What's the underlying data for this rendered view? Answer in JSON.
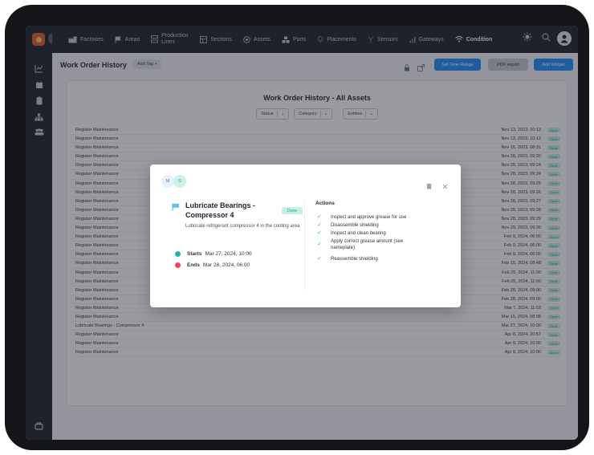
{
  "nav": {
    "items": [
      {
        "label": "Factories",
        "icon": "factory-icon"
      },
      {
        "label": "Areas",
        "icon": "flag-icon"
      },
      {
        "label": "Production Lines",
        "icon": "production-line-icon"
      },
      {
        "label": "Sections",
        "icon": "section-icon"
      },
      {
        "label": "Assets",
        "icon": "asset-icon"
      },
      {
        "label": "Parts",
        "icon": "parts-icon"
      },
      {
        "label": "Placements",
        "icon": "placement-icon"
      },
      {
        "label": "Sensors",
        "icon": "sensor-icon"
      },
      {
        "label": "Gateways",
        "icon": "gateway-icon"
      },
      {
        "label": "Condition",
        "icon": "condition-icon"
      }
    ]
  },
  "header": {
    "title": "Work Order History",
    "add_tag": "Add Tag +",
    "set_time_range": "Set Time Range",
    "pdf_export": "PDF export",
    "add_widget": "Add Widget"
  },
  "panel": {
    "title": "Work Order History - All Assets",
    "filters": [
      "Status",
      "Category",
      "Entities"
    ]
  },
  "rows": [
    {
      "name": "Register Maintenance",
      "date": "Nov 13, 2023, 10:13",
      "status": "Done"
    },
    {
      "name": "Register Maintenance",
      "date": "Nov 13, 2023, 10:13",
      "status": "Done"
    },
    {
      "name": "Register Maintenance",
      "date": "Nov 15, 2023, 08:31",
      "status": "Done"
    },
    {
      "name": "Register Maintenance",
      "date": "Nov 28, 2023, 09:20",
      "status": "Done"
    },
    {
      "name": "Register Maintenance",
      "date": "Nov 28, 2023, 09:24",
      "status": "Done"
    },
    {
      "name": "Register Maintenance",
      "date": "Nov 28, 2023, 09:24",
      "status": "Done"
    },
    {
      "name": "Register Maintenance",
      "date": "Nov 28, 2023, 09:25",
      "status": "Done"
    },
    {
      "name": "Register Maintenance",
      "date": "Nov 28, 2023, 09:26",
      "status": "Done"
    },
    {
      "name": "Register Maintenance",
      "date": "Nov 28, 2023, 09:27",
      "status": "Done"
    },
    {
      "name": "Register Maintenance",
      "date": "Nov 28, 2023, 09:28",
      "status": "Done"
    },
    {
      "name": "Register Maintenance",
      "date": "Nov 28, 2023, 09:29",
      "status": "Done"
    },
    {
      "name": "Register Maintenance",
      "date": "Nov 29, 2023, 09:30",
      "status": "Done"
    },
    {
      "name": "Register Maintenance",
      "date": "Feb 9, 2024, 06:00",
      "status": "Done"
    },
    {
      "name": "Register Maintenance",
      "date": "Feb 9, 2024, 06:00",
      "status": "Done"
    },
    {
      "name": "Register Maintenance",
      "date": "Feb 9, 2024, 06:00",
      "status": "Done"
    },
    {
      "name": "Register Maintenance",
      "date": "Feb 15, 2024, 08:48",
      "status": "Done"
    },
    {
      "name": "Register Maintenance",
      "date": "Feb 25, 2024, 11:00",
      "status": "Done"
    },
    {
      "name": "Register Maintenance",
      "date": "Feb 25, 2024, 11:00",
      "status": "Done"
    },
    {
      "name": "Register Maintenance",
      "date": "Feb 28, 2024, 09:00",
      "status": "Done"
    },
    {
      "name": "Register Maintenance",
      "date": "Feb 28, 2024, 09:00",
      "status": "Done"
    },
    {
      "name": "Register Maintenance",
      "date": "Mar 7, 2024, 11:53",
      "status": "Done"
    },
    {
      "name": "Register Maintenance",
      "date": "Mar 15, 2024, 08:08",
      "status": "Done"
    },
    {
      "name": "Lubricate Bearings - Compressor 4",
      "date": "Mar 27, 2024, 10:00",
      "status": "Done"
    },
    {
      "name": "Register Maintenance",
      "date": "Apr 8, 2024, 20:57",
      "status": "Done"
    },
    {
      "name": "Register Maintenance",
      "date": "Apr 9, 2024, 10:00",
      "status": "Done"
    },
    {
      "name": "Register Maintenance",
      "date": "Apr 9, 2024, 10:00",
      "status": "Done"
    }
  ],
  "modal": {
    "avatars": [
      "M",
      "S"
    ],
    "title": "Lubricate Bearings - Compressor 4",
    "status": "Done",
    "description": "Lubricate refrigerant compressor 4 in the cooling area",
    "starts_label": "Starts",
    "starts": "Mar 27, 2024, 10:00",
    "ends_label": "Ends",
    "ends": "Mar 28, 2024, 06:00",
    "actions_title": "Actions",
    "actions": [
      "Inspect and approve grease for use",
      "Disassemble shielding",
      "Inspect and clean bearing",
      "Apply correct grease amount (see nameplate)",
      "Reassemble shielding"
    ]
  },
  "colors": {
    "accent": "#1e90ff",
    "sidebar": "#20242c",
    "done_bg": "#c7efe8",
    "done_text": "#1aa092",
    "start_dot": "#1fb5b0",
    "end_dot": "#f0445a"
  }
}
